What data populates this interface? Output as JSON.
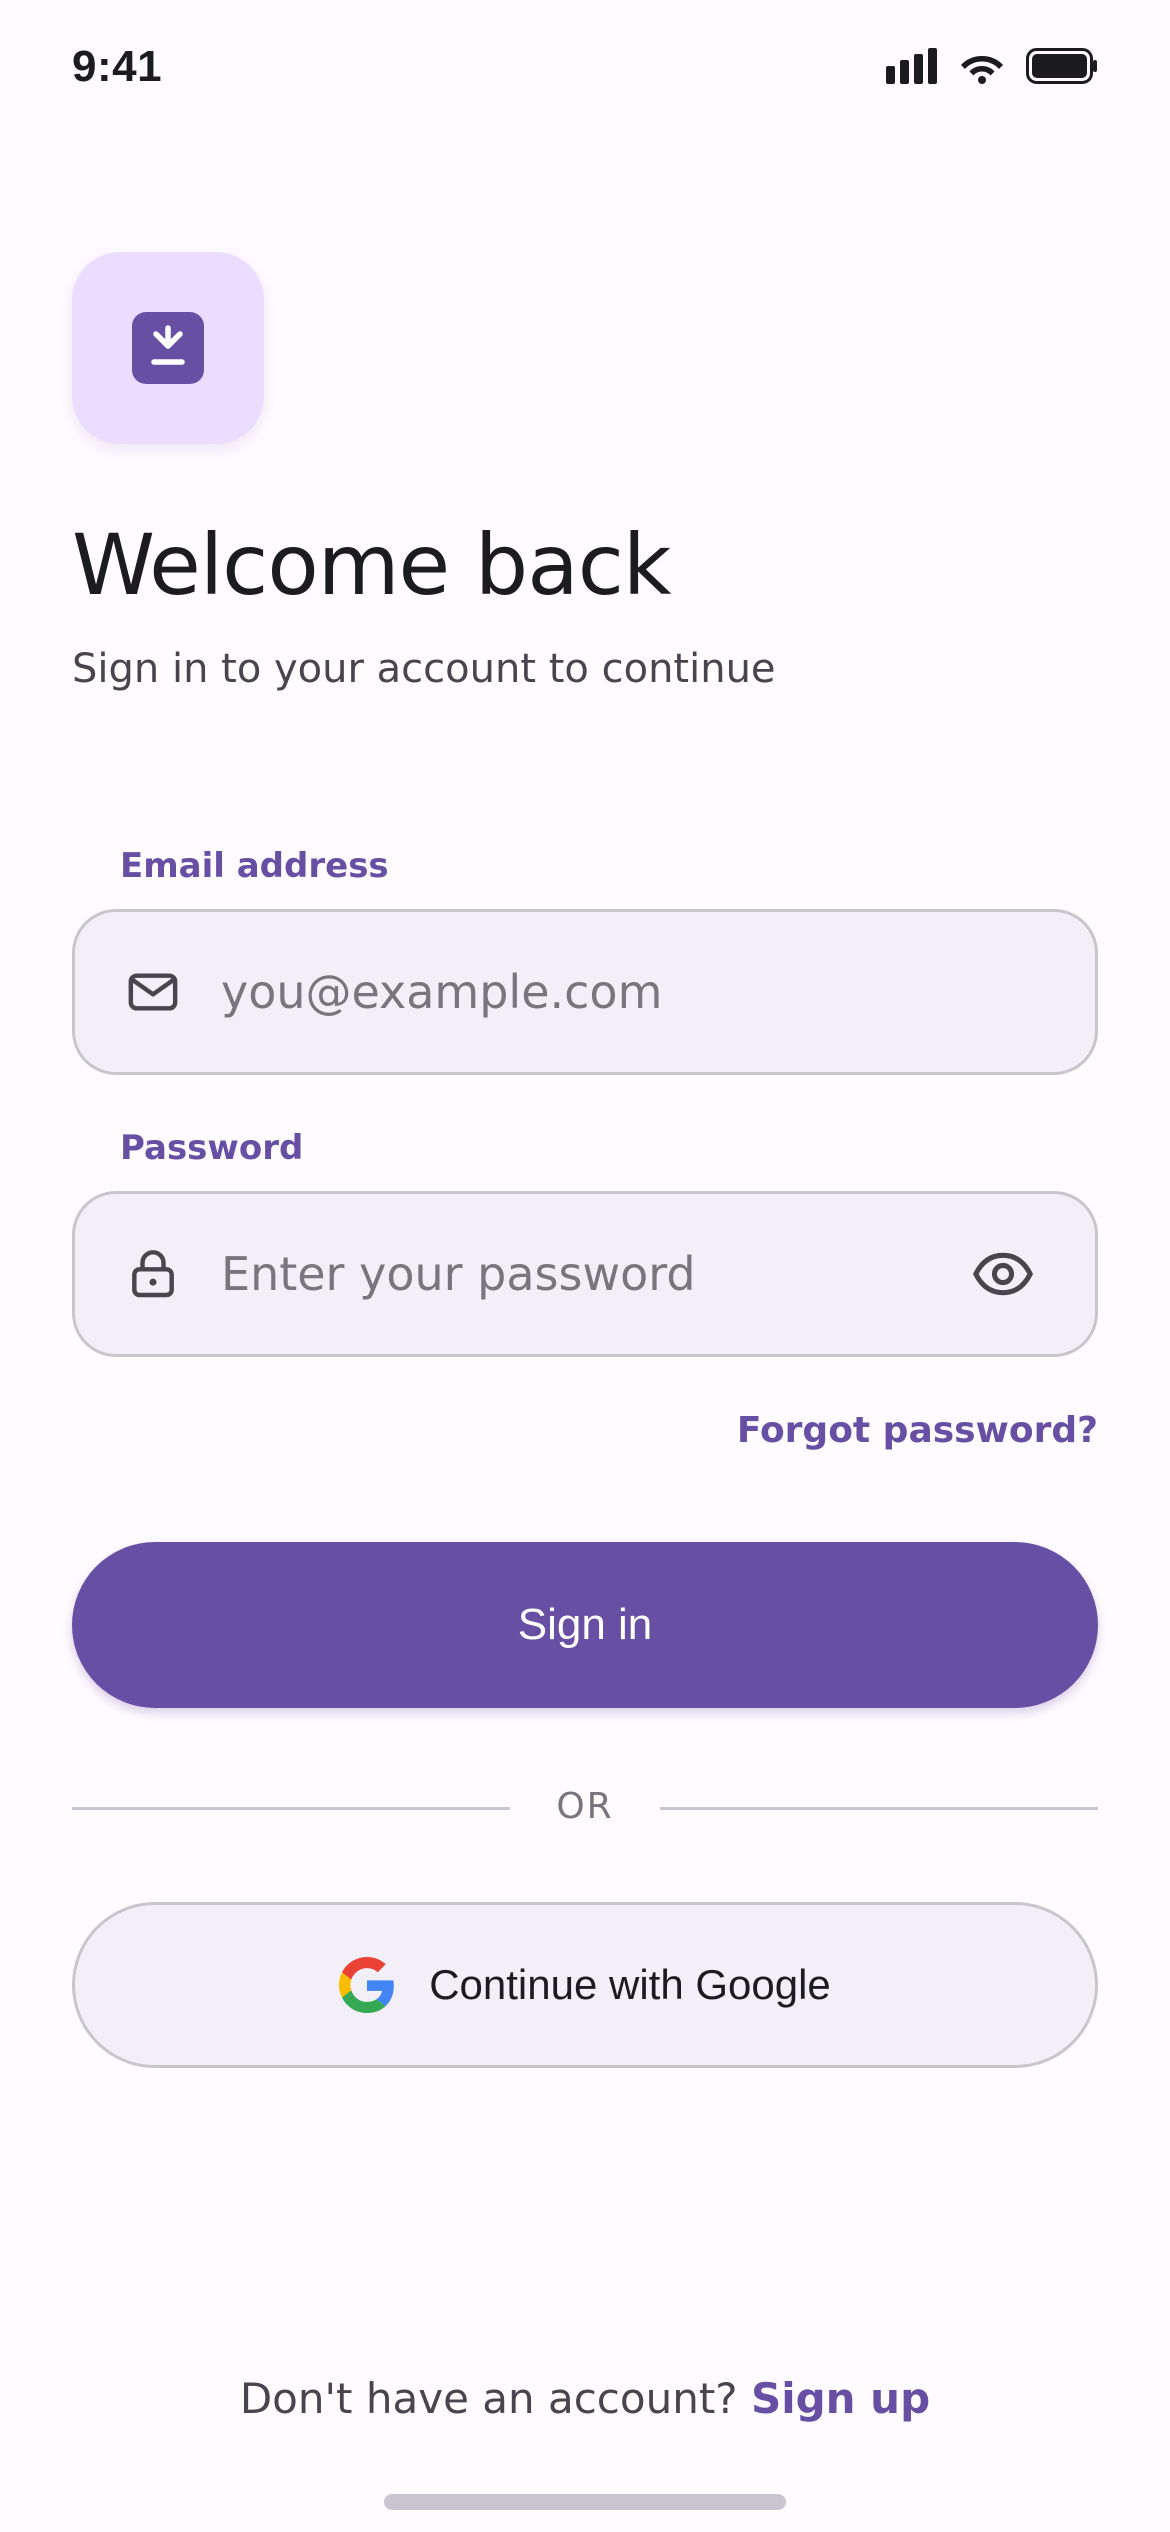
{
  "status_bar": {
    "time": "9:41",
    "icons": [
      "cellular-signal-icon",
      "wifi-icon",
      "battery-icon"
    ]
  },
  "logo": {
    "icon": "download-tray-icon"
  },
  "header": {
    "title": "Welcome back",
    "subtitle": "Sign in to your account to continue"
  },
  "form": {
    "email": {
      "label": "Email address",
      "value": "",
      "placeholder": "you@example.com",
      "icon": "mail-icon"
    },
    "password": {
      "label": "Password",
      "value": "",
      "placeholder": "Enter your password",
      "icon": "lock-icon",
      "toggle_icon": "eye-icon"
    },
    "forgot_label": "Forgot password?",
    "submit_label": "Sign in",
    "divider_label": "OR",
    "google_label": "Continue with Google",
    "google_icon": "google-logo-icon"
  },
  "footer": {
    "prompt": "Don't have an account?",
    "link_label": "Sign up"
  },
  "colors": {
    "primary": "#6750a4",
    "primary_container": "#eaddff",
    "surface": "#fffbff",
    "field_background": "#f3eff6",
    "outline": "#c9c5cc",
    "on_surface": "#1c1b1f",
    "on_surface_variant": "#49454f"
  }
}
